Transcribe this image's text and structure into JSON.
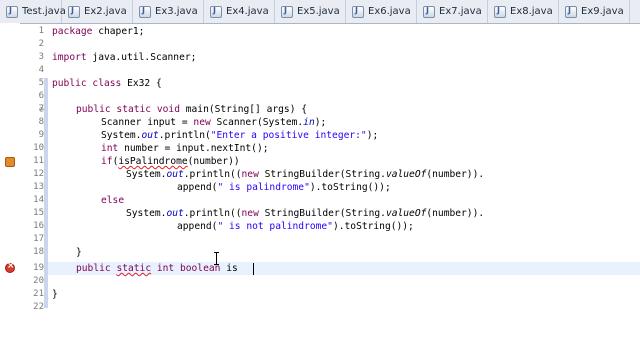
{
  "tabs": [
    {
      "label": "Test.java"
    },
    {
      "label": "Ex2.java"
    },
    {
      "label": "Ex3.java"
    },
    {
      "label": "Ex4.java"
    },
    {
      "label": "Ex5.java"
    },
    {
      "label": "Ex6.java"
    },
    {
      "label": "Ex7.java"
    },
    {
      "label": "Ex8.java"
    },
    {
      "label": "Ex9.java"
    }
  ],
  "editor": {
    "lines": [
      {
        "num": "1"
      },
      {
        "num": "2"
      },
      {
        "num": "3"
      },
      {
        "num": "4"
      },
      {
        "num": "5"
      },
      {
        "num": "6"
      },
      {
        "num": "7"
      },
      {
        "num": "8"
      },
      {
        "num": "9"
      },
      {
        "num": "10"
      },
      {
        "num": "11"
      },
      {
        "num": "12"
      },
      {
        "num": "13"
      },
      {
        "num": "14"
      },
      {
        "num": "15"
      },
      {
        "num": "16"
      },
      {
        "num": "17"
      },
      {
        "num": "18"
      },
      {
        "num": "19"
      },
      {
        "num": "20"
      },
      {
        "num": "21"
      },
      {
        "num": "22"
      }
    ],
    "code": {
      "l1_kw": "package",
      "l1_rest": " chaper1;",
      "l3_kw": "import",
      "l3_rest": " java.util.Scanner;",
      "l5_kw": "public class",
      "l5_rest": " Ex32 {",
      "l7_kw": "public static void",
      "l7_rest": " main(String[] args) {",
      "l8_a": "Scanner input = ",
      "l8_kw": "new",
      "l8_b": " Scanner(System.",
      "l8_fld": "in",
      "l8_c": ");",
      "l9_a": "System.",
      "l9_fld": "out",
      "l9_b": ".println(",
      "l9_str": "\"Enter a positive integer:\"",
      "l9_c": ");",
      "l10_kw": "int",
      "l10_rest": " number = input.nextInt();",
      "l11_kw": "if",
      "l11_a": "(",
      "l11_sq": "isPalindrome",
      "l11_b": "(number))",
      "l12_a": "System.",
      "l12_fld": "out",
      "l12_b": ".println((",
      "l12_kw": "new",
      "l12_c": " StringBuilder(String.",
      "l12_it": "valueOf",
      "l12_d": "(number)).",
      "l13_a": "append(",
      "l13_str": "\" is palindrome\"",
      "l13_b": ").toString());",
      "l14_kw": "else",
      "l15_a": "System.",
      "l15_fld": "out",
      "l15_b": ".println((",
      "l15_kw": "new",
      "l15_c": " StringBuilder(String.",
      "l15_it": "valueOf",
      "l15_d": "(number)).",
      "l16_a": "append(",
      "l16_str": "\" is not palindrome\"",
      "l16_b": ").toString());",
      "l18": "}",
      "l19_kw1": "public",
      "l19_sp1": " ",
      "l19_sq": "static",
      "l19_sp2": " ",
      "l19_kw2": "int boolean",
      "l19_rest": " is",
      "l21": "}"
    }
  },
  "colors": {
    "keyword": "#7f0055",
    "string": "#2a00ff",
    "field": "#0000c0",
    "error": "#d83b2d",
    "warning": "#e48a2a",
    "current_line": "#e8f2fe"
  },
  "icons": [
    "java-file-icon",
    "error-marker-icon",
    "warning-marker-icon",
    "fold-collapse-icon",
    "text-cursor-icon"
  ]
}
